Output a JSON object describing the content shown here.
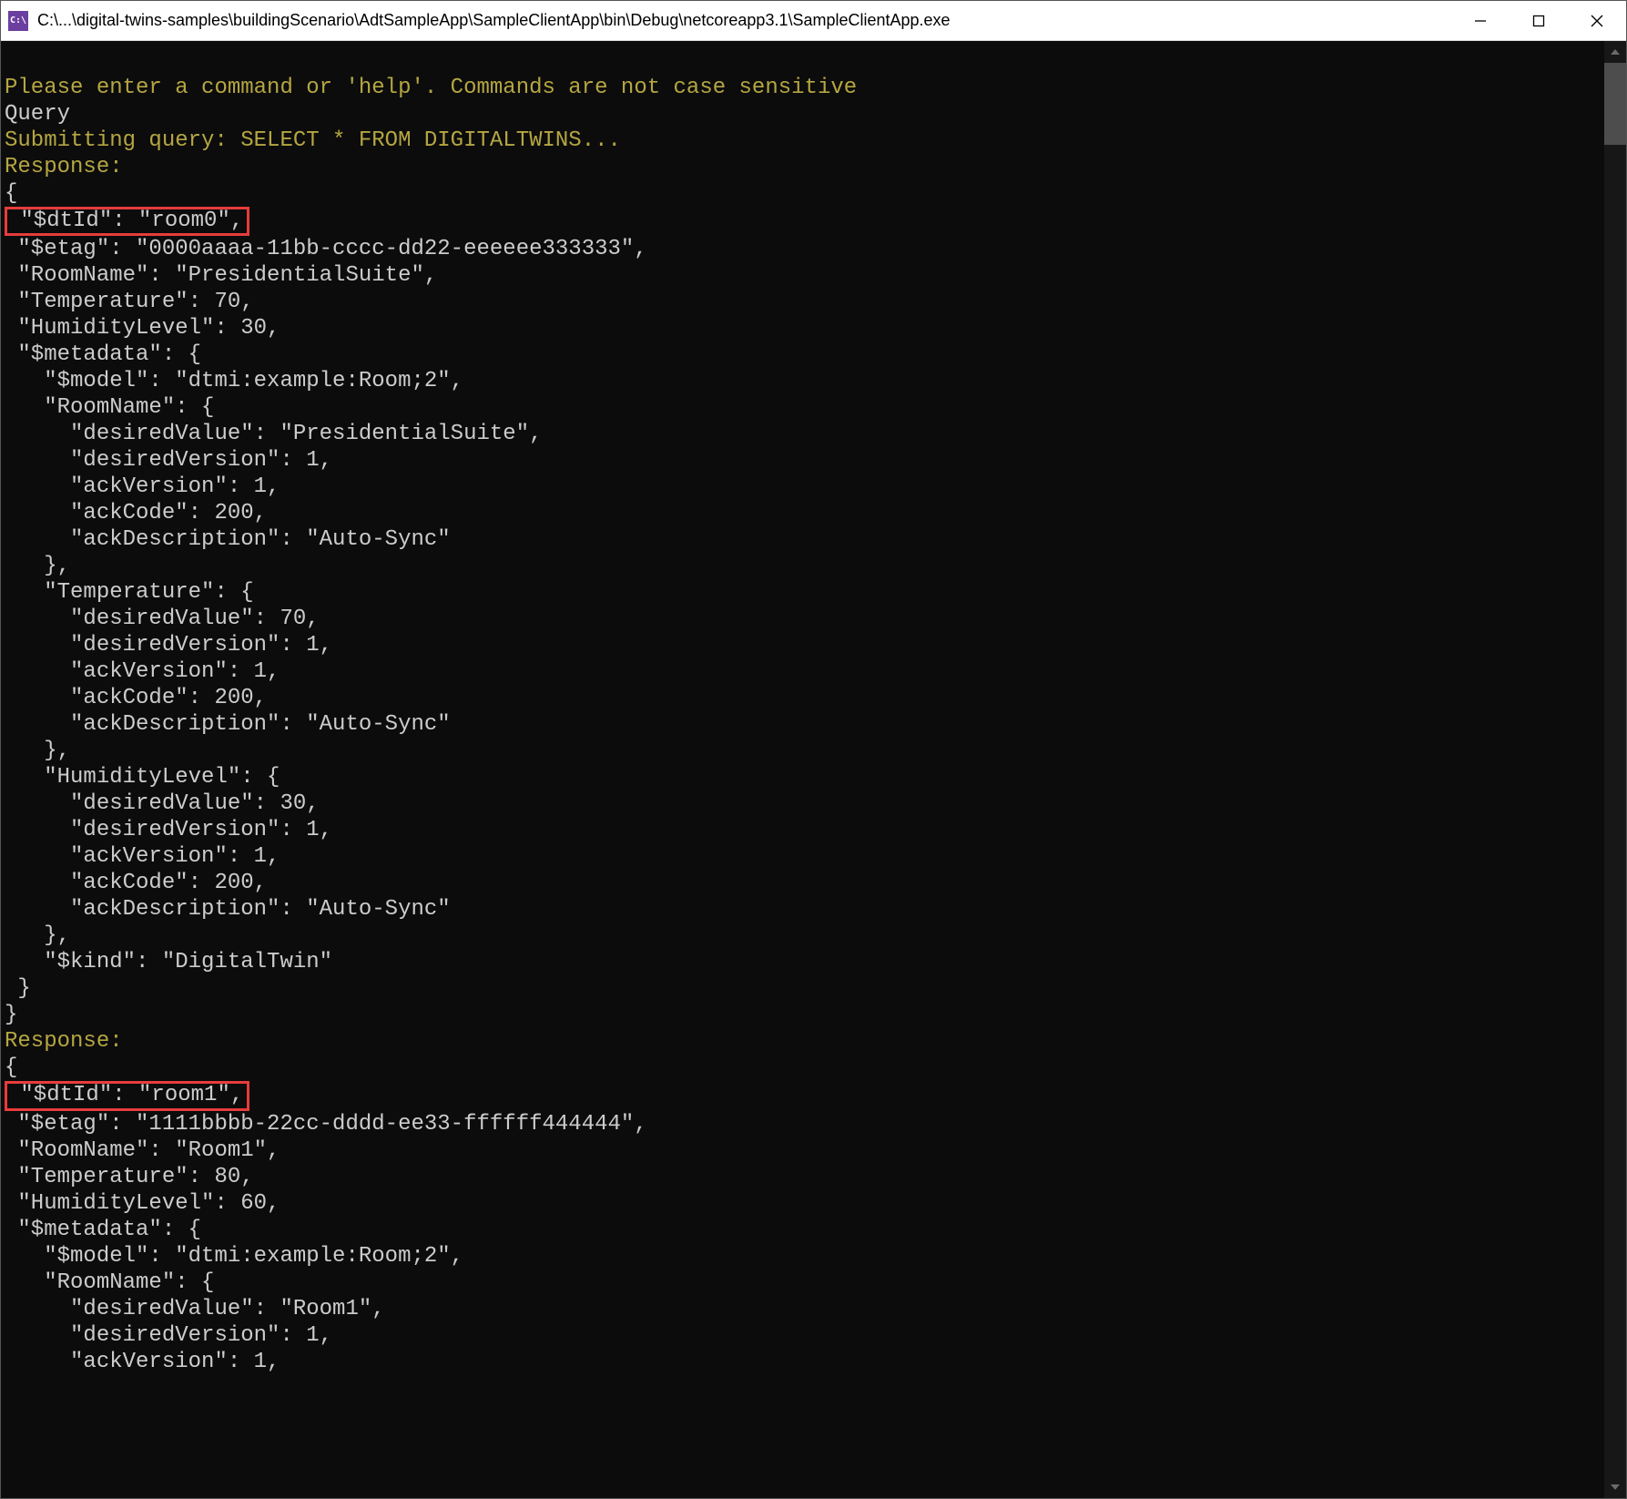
{
  "titlebar": {
    "icon_text": "C:\\",
    "path": "C:\\...\\digital-twins-samples\\buildingScenario\\AdtSampleApp\\SampleClientApp\\bin\\Debug\\netcoreapp3.1\\SampleClientApp.exe"
  },
  "console": {
    "prompt": "Please enter a command or 'help'. Commands are not case sensitive",
    "command": "Query",
    "submitting": "Submitting query: SELECT * FROM DIGITALTWINS...",
    "response_label": "Response:",
    "brace_open": "{",
    "brace_close": "}",
    "room0": {
      "dtid": " \"$dtId\": \"room0\",",
      "etag": " \"$etag\": \"0000aaaa-11bb-cccc-dd22-eeeeee333333\",",
      "roomname": " \"RoomName\": \"PresidentialSuite\",",
      "temperature": " \"Temperature\": 70,",
      "humidity": " \"HumidityLevel\": 30,",
      "metadata_open": " \"$metadata\": {",
      "model": "   \"$model\": \"dtmi:example:Room;2\",",
      "rn_open": "   \"RoomName\": {",
      "rn_desiredValue": "     \"desiredValue\": \"PresidentialSuite\",",
      "rn_desiredVersion": "     \"desiredVersion\": 1,",
      "rn_ackVersion": "     \"ackVersion\": 1,",
      "rn_ackCode": "     \"ackCode\": 200,",
      "rn_ackDesc": "     \"ackDescription\": \"Auto-Sync\"",
      "rn_close": "   },",
      "t_open": "   \"Temperature\": {",
      "t_desiredValue": "     \"desiredValue\": 70,",
      "t_desiredVersion": "     \"desiredVersion\": 1,",
      "t_ackVersion": "     \"ackVersion\": 1,",
      "t_ackCode": "     \"ackCode\": 200,",
      "t_ackDesc": "     \"ackDescription\": \"Auto-Sync\"",
      "t_close": "   },",
      "h_open": "   \"HumidityLevel\": {",
      "h_desiredValue": "     \"desiredValue\": 30,",
      "h_desiredVersion": "     \"desiredVersion\": 1,",
      "h_ackVersion": "     \"ackVersion\": 1,",
      "h_ackCode": "     \"ackCode\": 200,",
      "h_ackDesc": "     \"ackDescription\": \"Auto-Sync\"",
      "h_close": "   },",
      "kind": "   \"$kind\": \"DigitalTwin\"",
      "metadata_close": " }"
    },
    "room1": {
      "dtid": " \"$dtId\": \"room1\",",
      "etag": " \"$etag\": \"1111bbbb-22cc-dddd-ee33-ffffff444444\",",
      "roomname": " \"RoomName\": \"Room1\",",
      "temperature": " \"Temperature\": 80,",
      "humidity": " \"HumidityLevel\": 60,",
      "metadata_open": " \"$metadata\": {",
      "model": "   \"$model\": \"dtmi:example:Room;2\",",
      "rn_open": "   \"RoomName\": {",
      "rn_desiredValue": "     \"desiredValue\": \"Room1\",",
      "rn_desiredVersion": "     \"desiredVersion\": 1,",
      "rn_ackVersion": "     \"ackVersion\": 1,"
    }
  }
}
